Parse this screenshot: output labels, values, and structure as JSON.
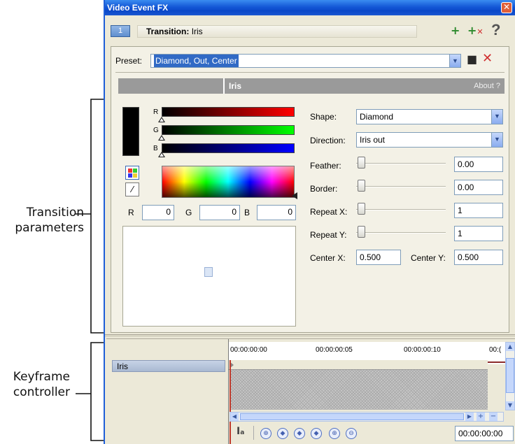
{
  "annotations": {
    "transition_line1": "Transition",
    "transition_line2": "parameters",
    "keyframe_line1": "Keyframe",
    "keyframe_line2": "controller"
  },
  "window": {
    "title": "Video Event FX",
    "close_glyph": "✕"
  },
  "tabbar": {
    "number": "1",
    "label_prefix": "Transition:",
    "label_value": "Iris",
    "add_icon_glyph": "+",
    "remove_icon_glyph": "+",
    "help_glyph": "?"
  },
  "preset": {
    "label": "Preset:",
    "value": "Diamond, Out, Center",
    "save_glyph": "■",
    "delete_glyph": "✕"
  },
  "plugin_bar": {
    "name": "Iris",
    "about": "About ?"
  },
  "color": {
    "r_label": "R",
    "g_label": "G",
    "b_label": "B",
    "r_value": "0",
    "g_value": "0",
    "b_value": "0",
    "swatch": "#000000"
  },
  "params": {
    "shape_label": "Shape:",
    "shape_value": "Diamond",
    "direction_label": "Direction:",
    "direction_value": "Iris out",
    "feather_label": "Feather:",
    "feather_value": "0.00",
    "border_label": "Border:",
    "border_value": "0.00",
    "repeatx_label": "Repeat X:",
    "repeatx_value": "1",
    "repeaty_label": "Repeat Y:",
    "repeaty_value": "1",
    "centerx_label": "Center X:",
    "centerx_value": "0.500",
    "centery_label": "Center Y:",
    "centery_value": "0.500"
  },
  "keyframes": {
    "track_label": "Iris",
    "ticks": [
      "00:00:00:00",
      "00:00:00:05",
      "00:00:00:10",
      "00:("
    ],
    "time_value": "00:00:00:00",
    "nav_glyphs": [
      "⊕",
      "◆",
      "◆",
      "◆",
      "⊕",
      "⊖"
    ]
  }
}
